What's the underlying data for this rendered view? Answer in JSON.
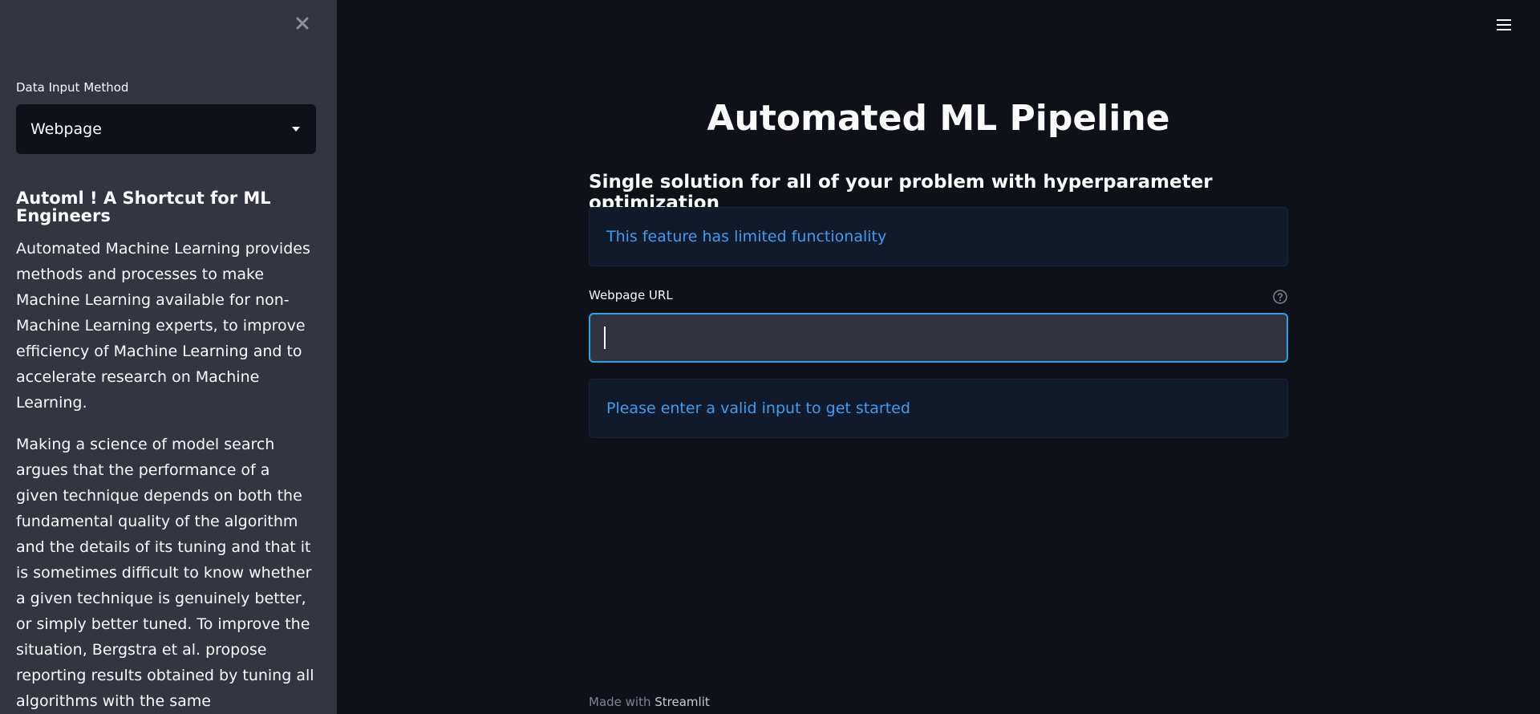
{
  "sidebar": {
    "close_icon": "close-icon",
    "input_method": {
      "label": "Data Input Method",
      "selected": "Webpage"
    },
    "heading": "Automl ! A Shortcut for ML Engineers",
    "paragraph_1": "Automated Machine Learning provides methods and processes to make Machine Learning available for non-Machine Learning experts, to improve efficiency of Machine Learning and to accelerate research on Machine Learning.",
    "paragraph_2": "Making a science of model search argues that the performance of a given technique depends on both the fundamental quality of the algorithm and the details of its tuning and that it is sometimes difficult to know whether a given technique is genuinely better, or simply better tuned. To improve the situation, Bergstra et al. propose reporting results obtained by tuning all algorithms with the same hyperparameter optimization toolkit."
  },
  "header": {
    "menu_icon": "hamburger-menu-icon"
  },
  "main": {
    "title": "Automated ML Pipeline",
    "subheading": "Single solution for all of your problem with hyperparameter optimization",
    "info_limited": "This feature has limited functionality",
    "url_field": {
      "label": "Webpage URL",
      "value": "",
      "help_icon": "help-icon"
    },
    "info_prompt": "Please enter a valid input to get started"
  },
  "footer": {
    "prefix": "Made with",
    "brand": "Streamlit"
  },
  "colors": {
    "background": "#0e1117",
    "sidebar": "#333541",
    "info_text": "#3d9df3",
    "input_focus_border": "#29a3e3"
  }
}
